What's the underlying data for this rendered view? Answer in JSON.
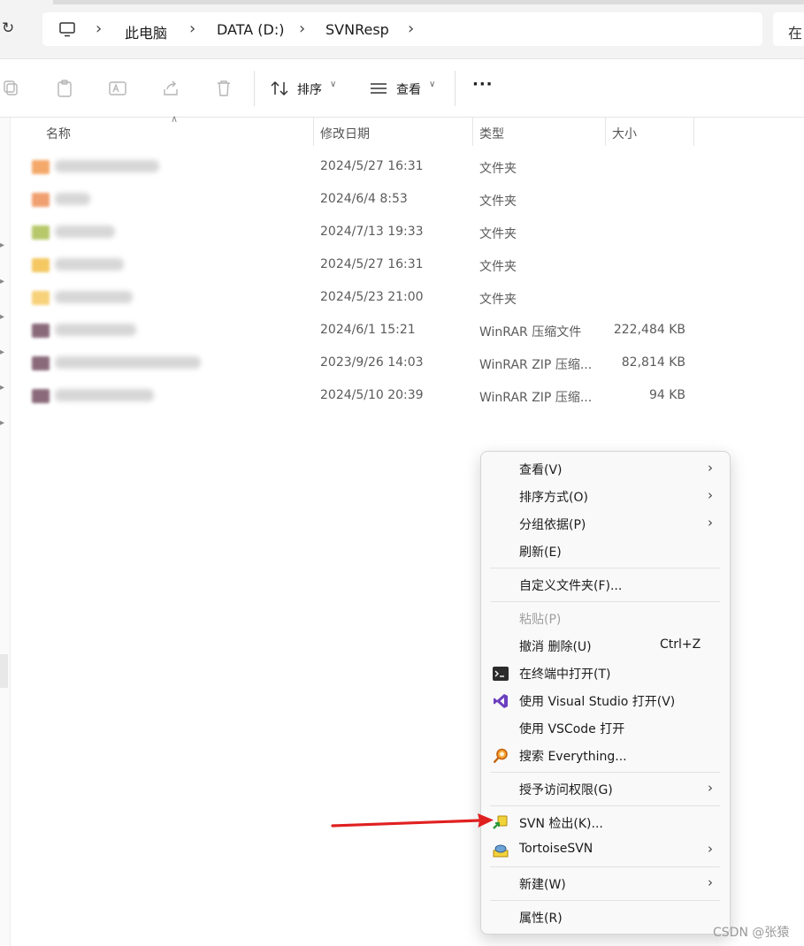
{
  "breadcrumb": {
    "items": [
      "此电脑",
      "DATA (D:)",
      "SVNResp"
    ],
    "search_partial": "在"
  },
  "toolbar": {
    "sort_label": "排序",
    "view_label": "查看",
    "more_label": "···"
  },
  "columns": {
    "name": "名称",
    "modified": "修改日期",
    "type": "类型",
    "size": "大小"
  },
  "files": [
    {
      "date": "2024/5/27 16:31",
      "type": "文件夹",
      "size": "",
      "icon_color": "#f4a96b"
    },
    {
      "date": "2024/6/4 8:53",
      "type": "文件夹",
      "size": "",
      "icon_color": "#f0a070"
    },
    {
      "date": "2024/7/13 19:33",
      "type": "文件夹",
      "size": "",
      "icon_color": "#b6c86a"
    },
    {
      "date": "2024/5/27 16:31",
      "type": "文件夹",
      "size": "",
      "icon_color": "#f5c862"
    },
    {
      "date": "2024/5/23 21:00",
      "type": "文件夹",
      "size": "",
      "icon_color": "#f7d27a"
    },
    {
      "date": "2024/6/1 15:21",
      "type": "WinRAR 压缩文件",
      "size": "222,484 KB",
      "icon_color": "#8a6a7a"
    },
    {
      "date": "2023/9/26 14:03",
      "type": "WinRAR ZIP 压缩...",
      "size": "82,814 KB",
      "icon_color": "#8a6a7a"
    },
    {
      "date": "2024/5/10 20:39",
      "type": "WinRAR ZIP 压缩...",
      "size": "94 KB",
      "icon_color": "#8a6a7a"
    }
  ],
  "context_menu": {
    "view": "查看(V)",
    "sort_by": "排序方式(O)",
    "group_by": "分组依据(P)",
    "refresh": "刷新(E)",
    "customize": "自定义文件夹(F)...",
    "paste": "粘贴(P)",
    "undo_delete": "撤消 删除(U)",
    "undo_shortcut": "Ctrl+Z",
    "open_terminal": "在终端中打开(T)",
    "open_vs": "使用 Visual Studio 打开(V)",
    "open_vscode": "使用 VSCode 打开",
    "search_everything": "搜索 Everything...",
    "grant_access": "授予访问权限(G)",
    "svn_checkout": "SVN 检出(K)...",
    "tortoisesvn": "TortoiseSVN",
    "new": "新建(W)",
    "properties": "属性(R)"
  },
  "watermark": "CSDN @张猿",
  "colors": {
    "accent_arrow": "#e02020",
    "menu_bg": "#f9f9f9",
    "vs_purple": "#6c3fbf",
    "everything_orange": "#e07a10"
  }
}
